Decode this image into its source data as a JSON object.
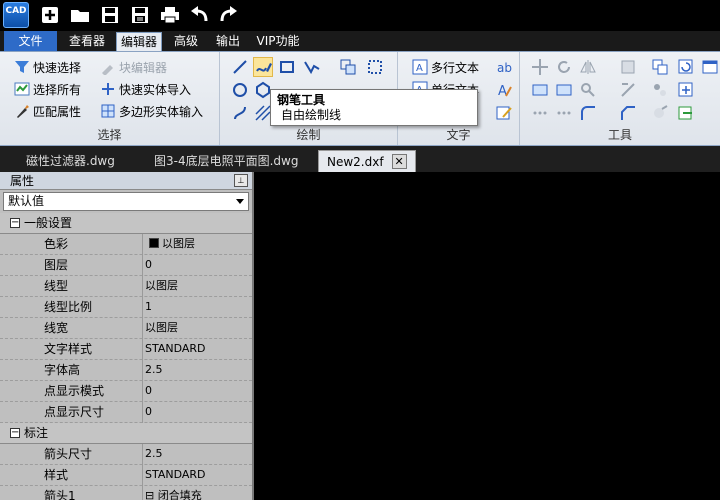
{
  "app": {
    "logo_text": "CAD"
  },
  "quick_access": [
    {
      "icon": "new-icon"
    },
    {
      "icon": "open-folder-icon"
    },
    {
      "icon": "save-icon"
    },
    {
      "icon": "save-as-icon"
    },
    {
      "icon": "print-icon"
    },
    {
      "icon": "undo-icon"
    },
    {
      "icon": "redo-icon"
    }
  ],
  "menu": {
    "file": "文件",
    "viewer": "查看器",
    "editor": "编辑器",
    "advanced": "高级",
    "output": "输出",
    "vip": "VIP功能"
  },
  "ribbon": {
    "select": {
      "title": "选择",
      "quick_select": "快速选择",
      "block_editor": "块编辑器",
      "select_all": "选择所有",
      "quick_entity_import": "快速实体导入",
      "match_properties": "匹配属性",
      "polygon_entity_input": "多边形实体输入"
    },
    "draw": {
      "title": "绘制"
    },
    "text": {
      "title": "文字",
      "mtext": "多行文本",
      "stext": "单行文本"
    },
    "tools": {
      "title": "工具"
    }
  },
  "tooltip": {
    "title": "钢笔工具",
    "description": "自由绘制线"
  },
  "doc_tabs": [
    {
      "label": "磁性过滤器.dwg",
      "active": false
    },
    {
      "label": "图3-4底层电照平面图.dwg",
      "active": false
    },
    {
      "label": "New2.dxf",
      "active": true
    }
  ],
  "properties": {
    "header": "属性",
    "filter_value": "默认值",
    "sections": {
      "general": "一般设置",
      "dimension": "标注"
    },
    "general_rows": [
      {
        "key": "色彩",
        "value": "以图层"
      },
      {
        "key": "图层",
        "value": "0"
      },
      {
        "key": "线型",
        "value": "以图层"
      },
      {
        "key": "线型比例",
        "value": "1"
      },
      {
        "key": "线宽",
        "value": "以图层"
      },
      {
        "key": "文字样式",
        "value": "STANDARD"
      },
      {
        "key": "字体高",
        "value": "2.5"
      },
      {
        "key": "点显示模式",
        "value": "0"
      },
      {
        "key": "点显示尺寸",
        "value": "0"
      }
    ],
    "dimension_rows": [
      {
        "key": "箭头尺寸",
        "value": "2.5"
      },
      {
        "key": "样式",
        "value": "STANDARD"
      },
      {
        "key": "箭头1",
        "value": "闭合填充"
      }
    ]
  },
  "colors": {
    "accent": "#2e6bc8",
    "canvas": "#000000",
    "highlight": "#fbe59a"
  }
}
